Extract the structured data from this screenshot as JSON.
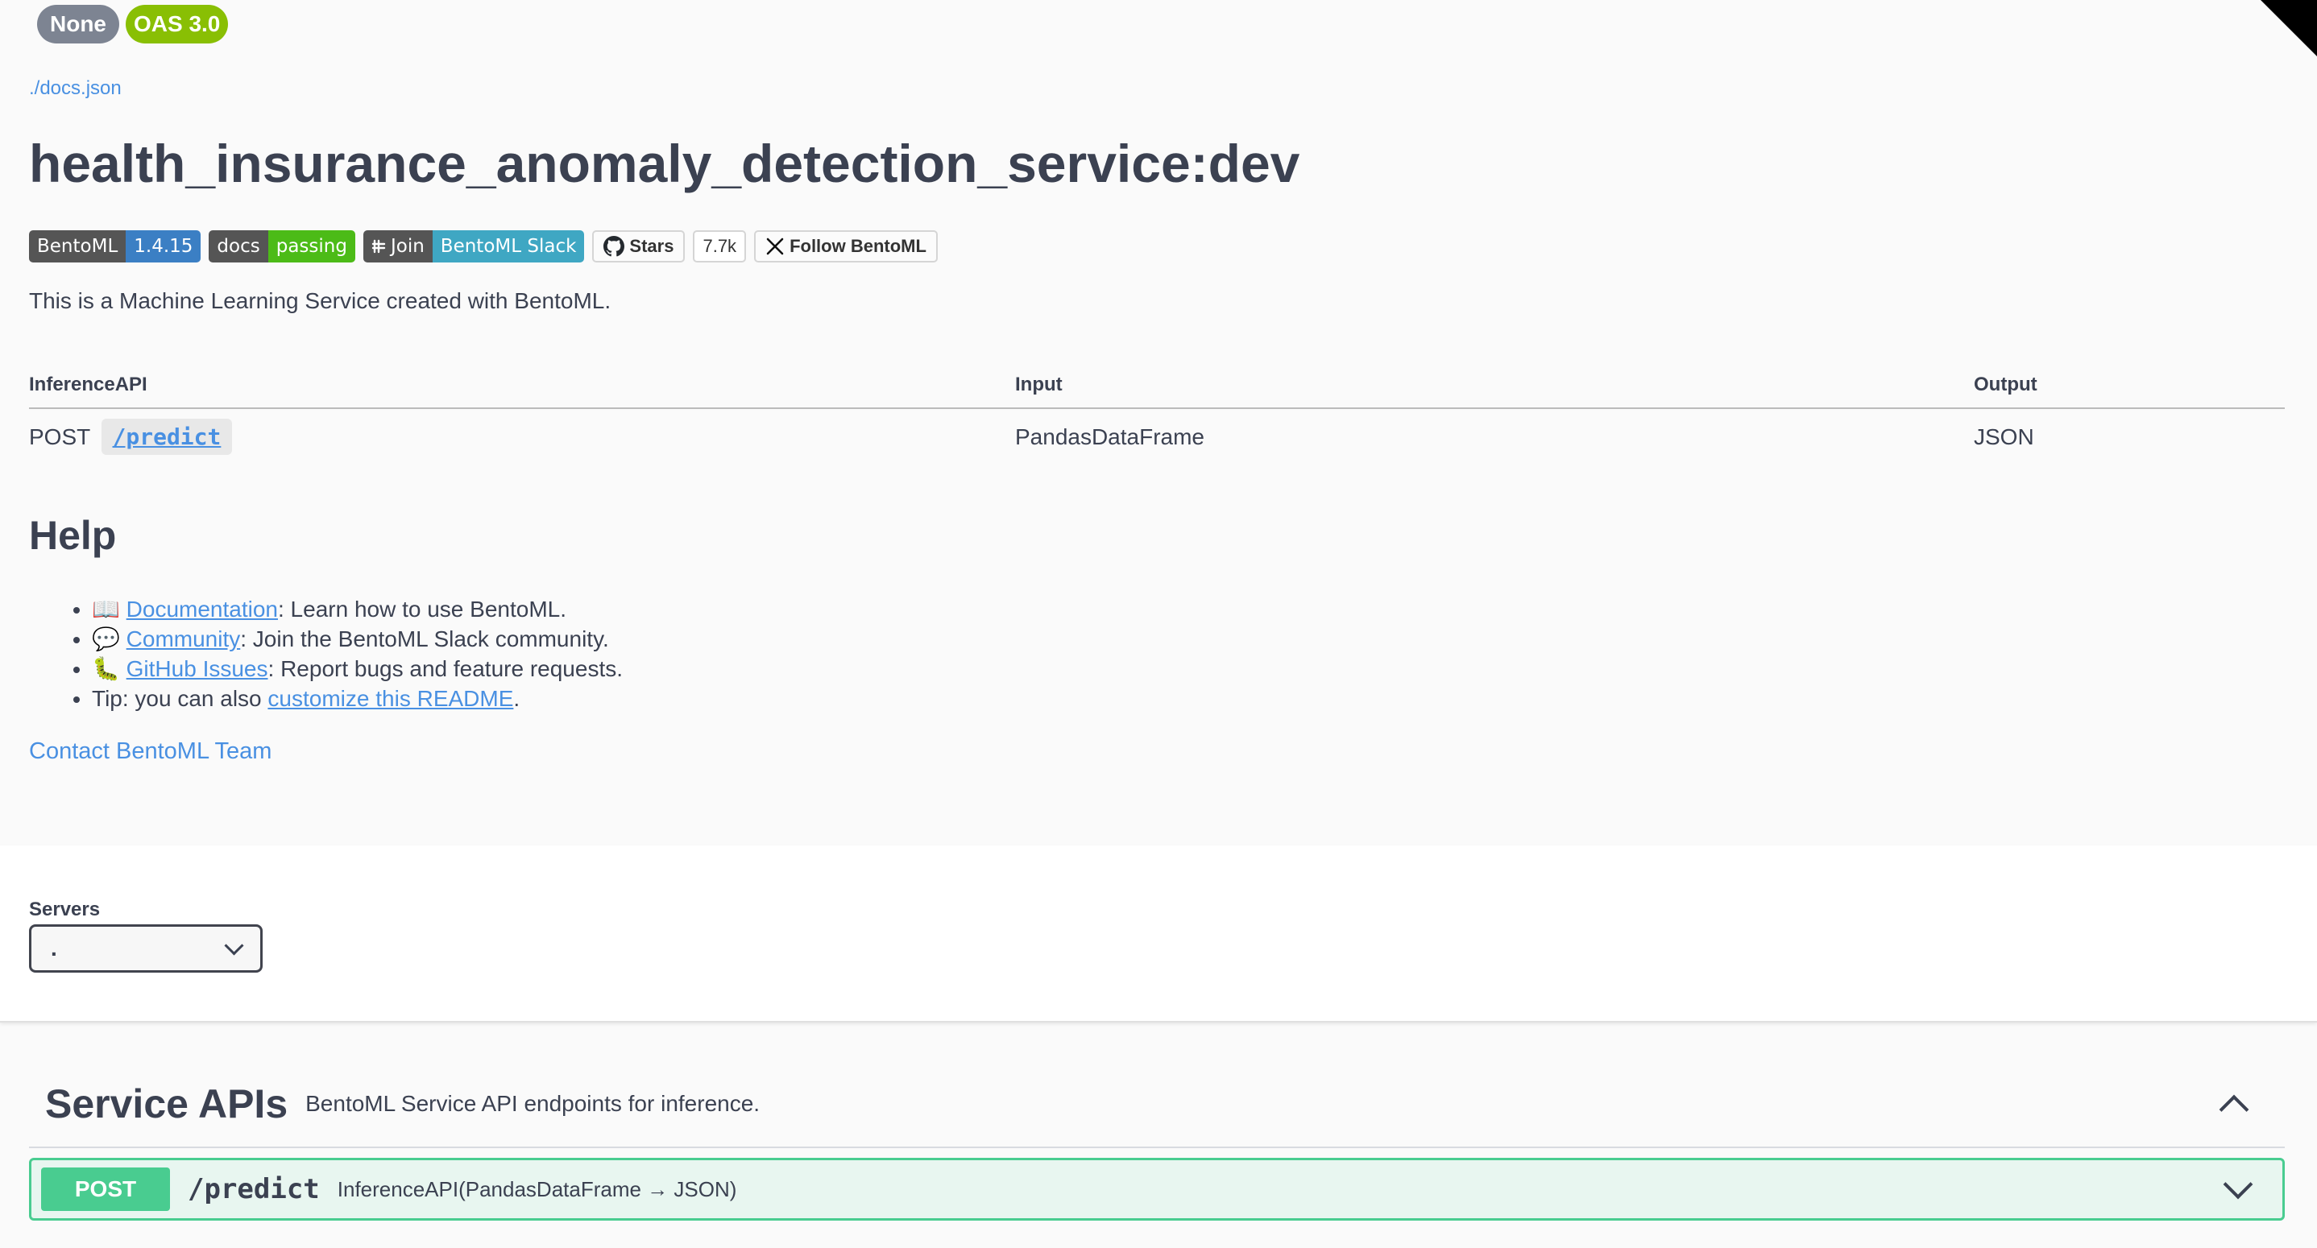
{
  "info": {
    "version_badges": [
      "None",
      "OAS 3.0"
    ],
    "docs_link": "./docs.json",
    "title": "health_insurance_anomaly_detection_service:dev",
    "shields": {
      "bentoml_label": "BentoML",
      "bentoml_version": "1.4.15",
      "docs_label": "docs",
      "docs_status": "passing",
      "join_label": "Join",
      "slack_label": "BentoML Slack",
      "github_stars_label": "Stars",
      "github_stars_count": "7.7k",
      "follow_label": "Follow BentoML"
    },
    "description": "This is a Machine Learning Service created with BentoML.",
    "api_table": {
      "headers": [
        "InferenceAPI",
        "Input",
        "Output"
      ],
      "rows": [
        {
          "method": "POST",
          "endpoint": "/predict",
          "input": "PandasDataFrame",
          "output": "JSON"
        }
      ]
    },
    "help": {
      "heading": "Help",
      "items": [
        {
          "emoji": "📖",
          "link": "Documentation",
          "text": ": Learn how to use BentoML."
        },
        {
          "emoji": "💬",
          "link": "Community",
          "text": ": Join the BentoML Slack community."
        },
        {
          "emoji": "🐛",
          "link": "GitHub Issues",
          "text": ": Report bugs and feature requests."
        },
        {
          "prefix": "Tip: you can also ",
          "link": "customize this README",
          "text": "."
        }
      ]
    },
    "contact": "Contact BentoML Team"
  },
  "servers": {
    "label": "Servers",
    "selected": "."
  },
  "service_apis": {
    "name": "Service APIs",
    "description": "BentoML Service API endpoints for inference.",
    "operations": [
      {
        "method": "POST",
        "path": "/predict",
        "summary": "InferenceAPI(PandasDataFrame → JSON)"
      }
    ]
  },
  "colors": {
    "link": "#4990e2",
    "post": "#49cc90",
    "post_bg": "#e8f6f0",
    "text": "#3b4151"
  },
  "icons": [
    "github-icon",
    "x-logo-icon",
    "slack-icon",
    "chevron-down-icon",
    "chevron-up-icon"
  ]
}
